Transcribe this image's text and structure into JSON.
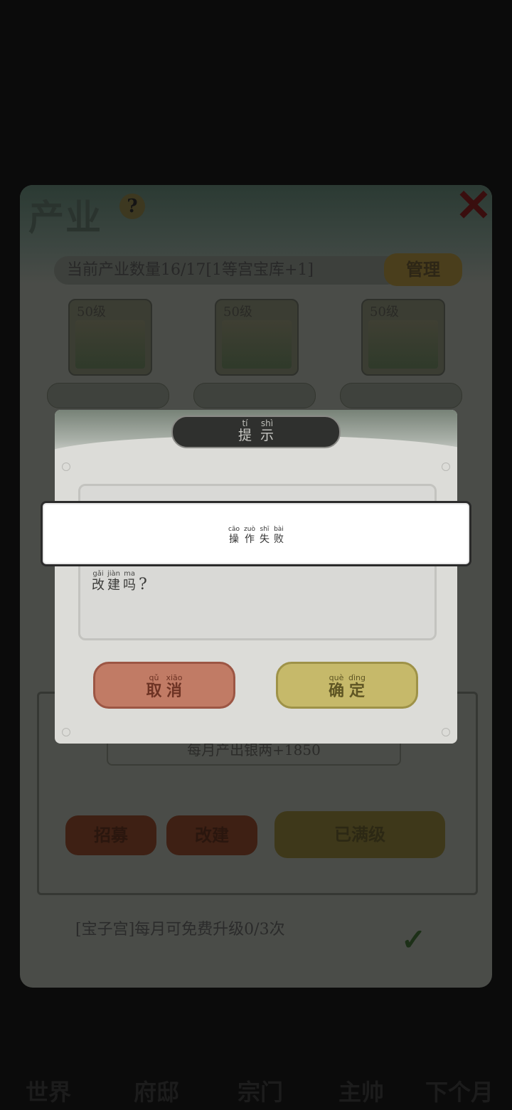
{
  "background": {
    "panel_title": "产业",
    "help_icon": "?",
    "info_bar": "当前产业数量16/17[1等宫宝库+1]",
    "manage_button": "管理",
    "cards": [
      {
        "label": "50级"
      },
      {
        "label": "50级"
      },
      {
        "label": "50级"
      }
    ],
    "production_text": "每月产出银两+1850",
    "footer_text": "[宝子宫]每月可免费升级0/3次",
    "buttons": [
      "招募",
      "改建",
      "已满级"
    ],
    "nav": [
      "世界",
      "府邸",
      "宗门",
      "主帅",
      "下个月"
    ]
  },
  "dialog": {
    "title": [
      {
        "py": "tí",
        "hz": "提"
      },
      {
        "py": "shì",
        "hz": "示"
      }
    ],
    "message_visible": [
      {
        "py": "gǎi",
        "hz": "改"
      },
      {
        "py": "jiàn",
        "hz": "建"
      },
      {
        "py": "ma",
        "hz": "吗"
      }
    ],
    "message_end": "?",
    "cancel": [
      {
        "py": "qǔ",
        "hz": "取"
      },
      {
        "py": "xiāo",
        "hz": "消"
      }
    ],
    "ok": [
      {
        "py": "què",
        "hz": "确"
      },
      {
        "py": "dìng",
        "hz": "定"
      }
    ]
  },
  "toast": [
    {
      "py": "cāo",
      "hz": "操"
    },
    {
      "py": "zuò",
      "hz": "作"
    },
    {
      "py": "shī",
      "hz": "失"
    },
    {
      "py": "bài",
      "hz": "败"
    }
  ]
}
